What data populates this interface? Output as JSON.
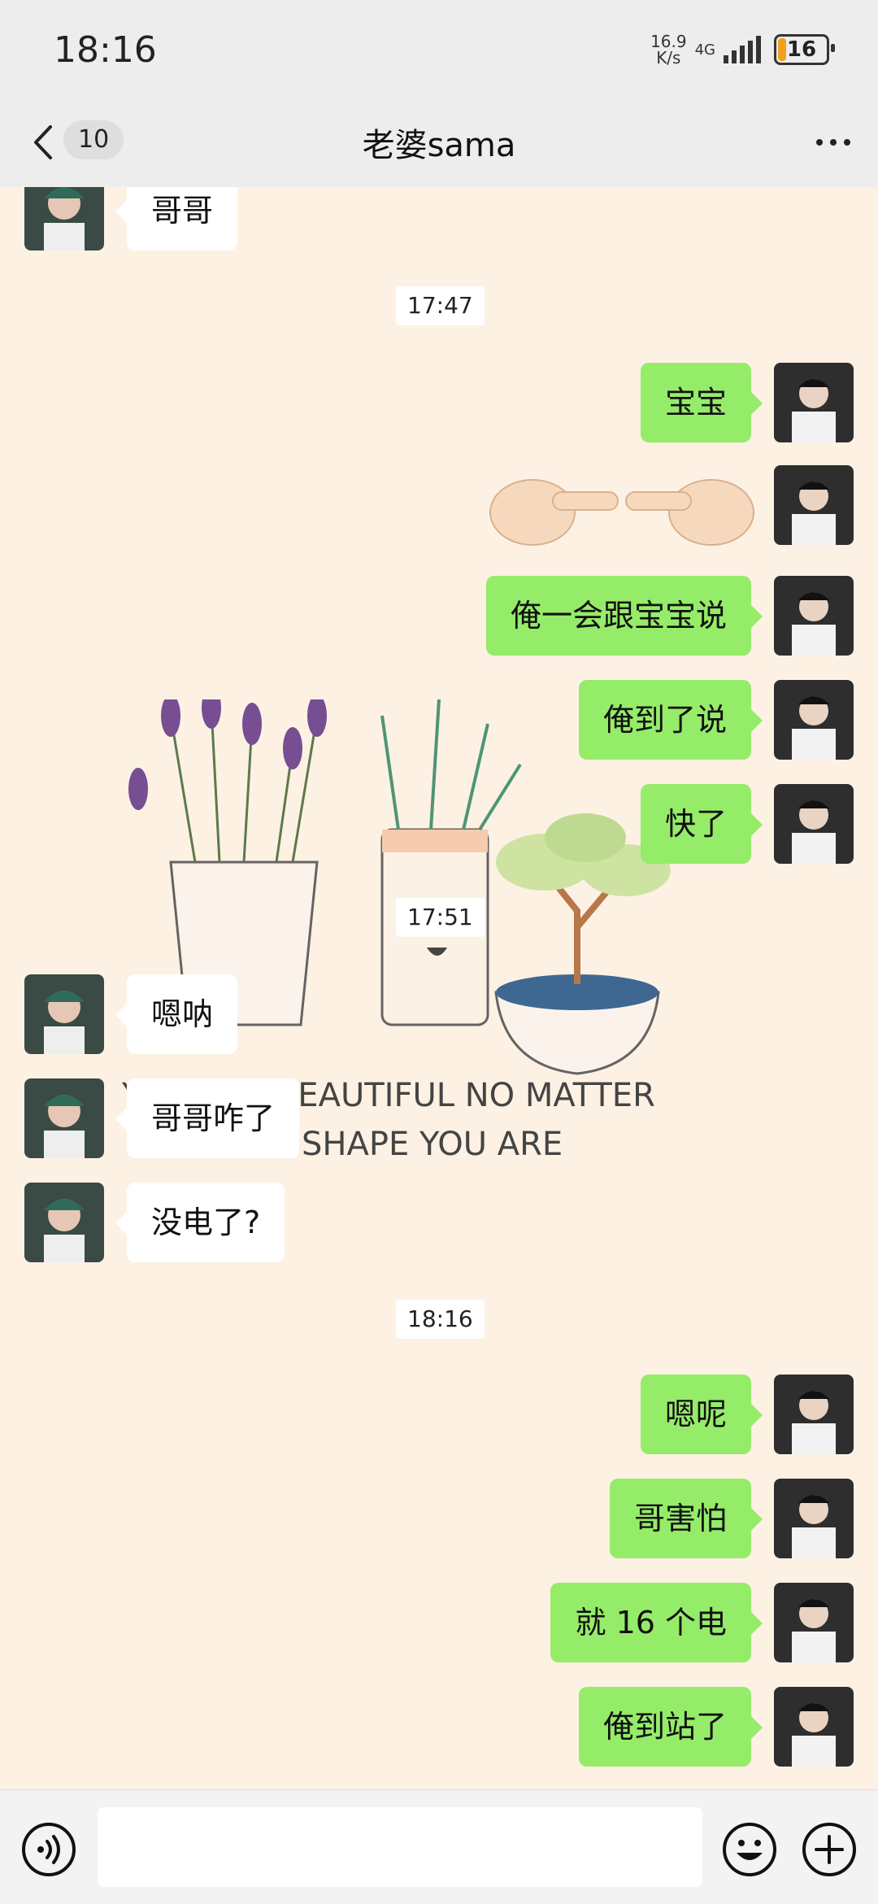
{
  "status_bar": {
    "time": "18:16",
    "net_speed_value": "16.9",
    "net_speed_unit": "K/s",
    "network": "4G",
    "battery": "16"
  },
  "header": {
    "back_count": "10",
    "title": "老婆sama"
  },
  "background_text": [
    "YOU ARE BEAUTIFUL NO MATTER",
    "WHAT SHAPE YOU ARE"
  ],
  "messages": [
    {
      "side": "left",
      "text": "哥哥"
    },
    {
      "type": "timestamp",
      "text": "17:47"
    },
    {
      "side": "right",
      "text": "宝宝"
    },
    {
      "side": "right",
      "type": "emoji",
      "icon": "pointing-fingers"
    },
    {
      "side": "right",
      "text": "俺一会跟宝宝说"
    },
    {
      "side": "right",
      "text": "俺到了说"
    },
    {
      "side": "right",
      "text": "快了"
    },
    {
      "type": "timestamp",
      "text": "17:51"
    },
    {
      "side": "left",
      "text": "嗯呐"
    },
    {
      "side": "left",
      "text": "哥哥咋了"
    },
    {
      "side": "left",
      "text": "没电了?"
    },
    {
      "type": "timestamp",
      "text": "18:16"
    },
    {
      "side": "right",
      "text": "嗯呢"
    },
    {
      "side": "right",
      "text": "哥害怕"
    },
    {
      "side": "right",
      "text": "就 16 个电"
    },
    {
      "side": "right",
      "text": "俺到站了"
    }
  ],
  "input_bar": {
    "placeholder": "",
    "voice_icon": "voice-icon",
    "emoji_icon": "emoji-icon",
    "plus_icon": "plus-icon"
  },
  "colors": {
    "chat_bg": "#fdf1e4",
    "my_bubble": "#95ec69",
    "their_bubble": "#ffffff",
    "battery_accent": "#f0a020"
  }
}
